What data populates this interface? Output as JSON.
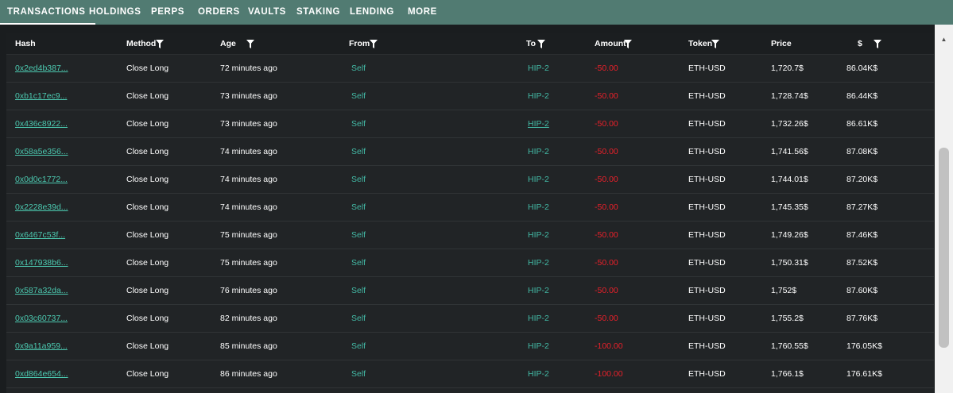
{
  "tabs": [
    {
      "label": "TRANSACTIONS",
      "active": true
    },
    {
      "label": "HOLDINGS"
    },
    {
      "label": "PERPS"
    },
    {
      "label": "ORDERS"
    },
    {
      "label": "VAULTS"
    },
    {
      "label": "STAKING"
    },
    {
      "label": "LENDING"
    },
    {
      "label": "MORE"
    }
  ],
  "colors": {
    "tab_bar": "#517b72",
    "background": "#1a1d1f",
    "panel": "#212426",
    "link": "#4cc9b0",
    "teal_text": "#43b9a5",
    "negative": "#e8202a"
  },
  "table": {
    "columns": [
      "Hash",
      "Method",
      "Age",
      "From",
      "To",
      "Amount",
      "Token",
      "Price",
      "$"
    ],
    "filterable": [
      "Method",
      "Age",
      "From",
      "To",
      "Amount",
      "Token",
      "$"
    ],
    "rows": [
      {
        "hash": "0x2ed4b387...",
        "method": "Close Long",
        "age": "72 minutes ago",
        "from": "Self",
        "to": "HIP-2",
        "amount": "-50.00",
        "token": "ETH-USD",
        "price": "1,720.7$",
        "usd": "86.04K$"
      },
      {
        "hash": "0xb1c17ec9...",
        "method": "Close Long",
        "age": "73 minutes ago",
        "from": "Self",
        "to": "HIP-2",
        "amount": "-50.00",
        "token": "ETH-USD",
        "price": "1,728.74$",
        "usd": "86.44K$"
      },
      {
        "hash": "0x436c8922...",
        "method": "Close Long",
        "age": "73 minutes ago",
        "from": "Self",
        "to": "HIP-2",
        "amount": "-50.00",
        "token": "ETH-USD",
        "price": "1,732.26$",
        "usd": "86.61K$",
        "to_hovered": true
      },
      {
        "hash": "0x58a5e356...",
        "method": "Close Long",
        "age": "74 minutes ago",
        "from": "Self",
        "to": "HIP-2",
        "amount": "-50.00",
        "token": "ETH-USD",
        "price": "1,741.56$",
        "usd": "87.08K$"
      },
      {
        "hash": "0x0d0c1772...",
        "method": "Close Long",
        "age": "74 minutes ago",
        "from": "Self",
        "to": "HIP-2",
        "amount": "-50.00",
        "token": "ETH-USD",
        "price": "1,744.01$",
        "usd": "87.20K$"
      },
      {
        "hash": "0x2228e39d...",
        "method": "Close Long",
        "age": "74 minutes ago",
        "from": "Self",
        "to": "HIP-2",
        "amount": "-50.00",
        "token": "ETH-USD",
        "price": "1,745.35$",
        "usd": "87.27K$"
      },
      {
        "hash": "0x6467c53f...",
        "method": "Close Long",
        "age": "75 minutes ago",
        "from": "Self",
        "to": "HIP-2",
        "amount": "-50.00",
        "token": "ETH-USD",
        "price": "1,749.26$",
        "usd": "87.46K$"
      },
      {
        "hash": "0x147938b6...",
        "method": "Close Long",
        "age": "75 minutes ago",
        "from": "Self",
        "to": "HIP-2",
        "amount": "-50.00",
        "token": "ETH-USD",
        "price": "1,750.31$",
        "usd": "87.52K$"
      },
      {
        "hash": "0x587a32da...",
        "method": "Close Long",
        "age": "76 minutes ago",
        "from": "Self",
        "to": "HIP-2",
        "amount": "-50.00",
        "token": "ETH-USD",
        "price": "1,752$",
        "usd": "87.60K$"
      },
      {
        "hash": "0x03c60737...",
        "method": "Close Long",
        "age": "82 minutes ago",
        "from": "Self",
        "to": "HIP-2",
        "amount": "-50.00",
        "token": "ETH-USD",
        "price": "1,755.2$",
        "usd": "87.76K$"
      },
      {
        "hash": "0x9a11a959...",
        "method": "Close Long",
        "age": "85 minutes ago",
        "from": "Self",
        "to": "HIP-2",
        "amount": "-100.00",
        "token": "ETH-USD",
        "price": "1,760.55$",
        "usd": "176.05K$"
      },
      {
        "hash": "0xd864e654...",
        "method": "Close Long",
        "age": "86 minutes ago",
        "from": "Self",
        "to": "HIP-2",
        "amount": "-100.00",
        "token": "ETH-USD",
        "price": "1,766.1$",
        "usd": "176.61K$"
      }
    ]
  }
}
